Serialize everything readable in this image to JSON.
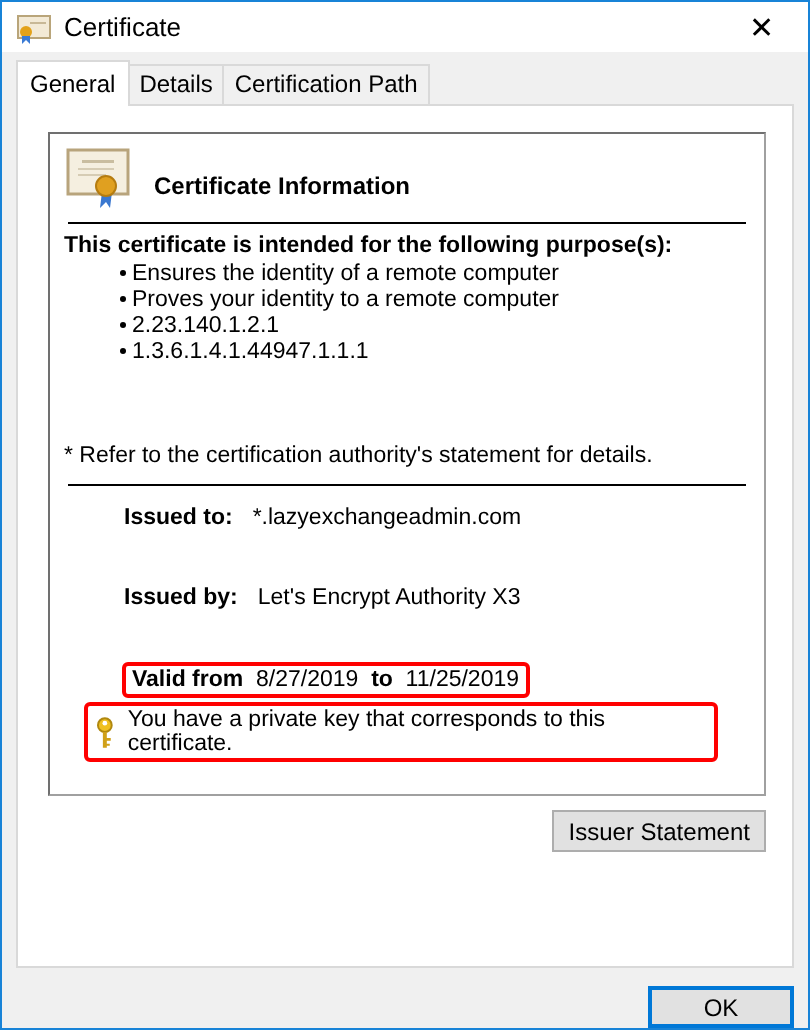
{
  "window": {
    "title": "Certificate",
    "close": "✕"
  },
  "tabs": [
    {
      "label": "General",
      "selected": true
    },
    {
      "label": "Details",
      "selected": false
    },
    {
      "label": "Certification Path",
      "selected": false
    }
  ],
  "info": {
    "title": "Certificate Information",
    "purpose_heading": "This certificate is intended for the following purpose(s):",
    "purposes": [
      "Ensures the identity of a remote computer",
      "Proves your identity to a remote computer",
      "2.23.140.1.2.1",
      "1.3.6.1.4.1.44947.1.1.1"
    ],
    "note": "* Refer to the certification authority's statement for details.",
    "issued_to": {
      "label": "Issued to:",
      "value": "*.lazyexchangeadmin.com"
    },
    "issued_by": {
      "label": "Issued by:",
      "value": "Let's Encrypt Authority X3"
    },
    "validity": {
      "text": "**Valid from**  8/27/2019  **to**  11/25/2019",
      "highlighted": true
    },
    "private_key": {
      "text": "You have a private key that corresponds to this certificate.",
      "highlighted": true
    }
  },
  "issuer_button": "Issuer Statement",
  "ok_button": "OK"
}
